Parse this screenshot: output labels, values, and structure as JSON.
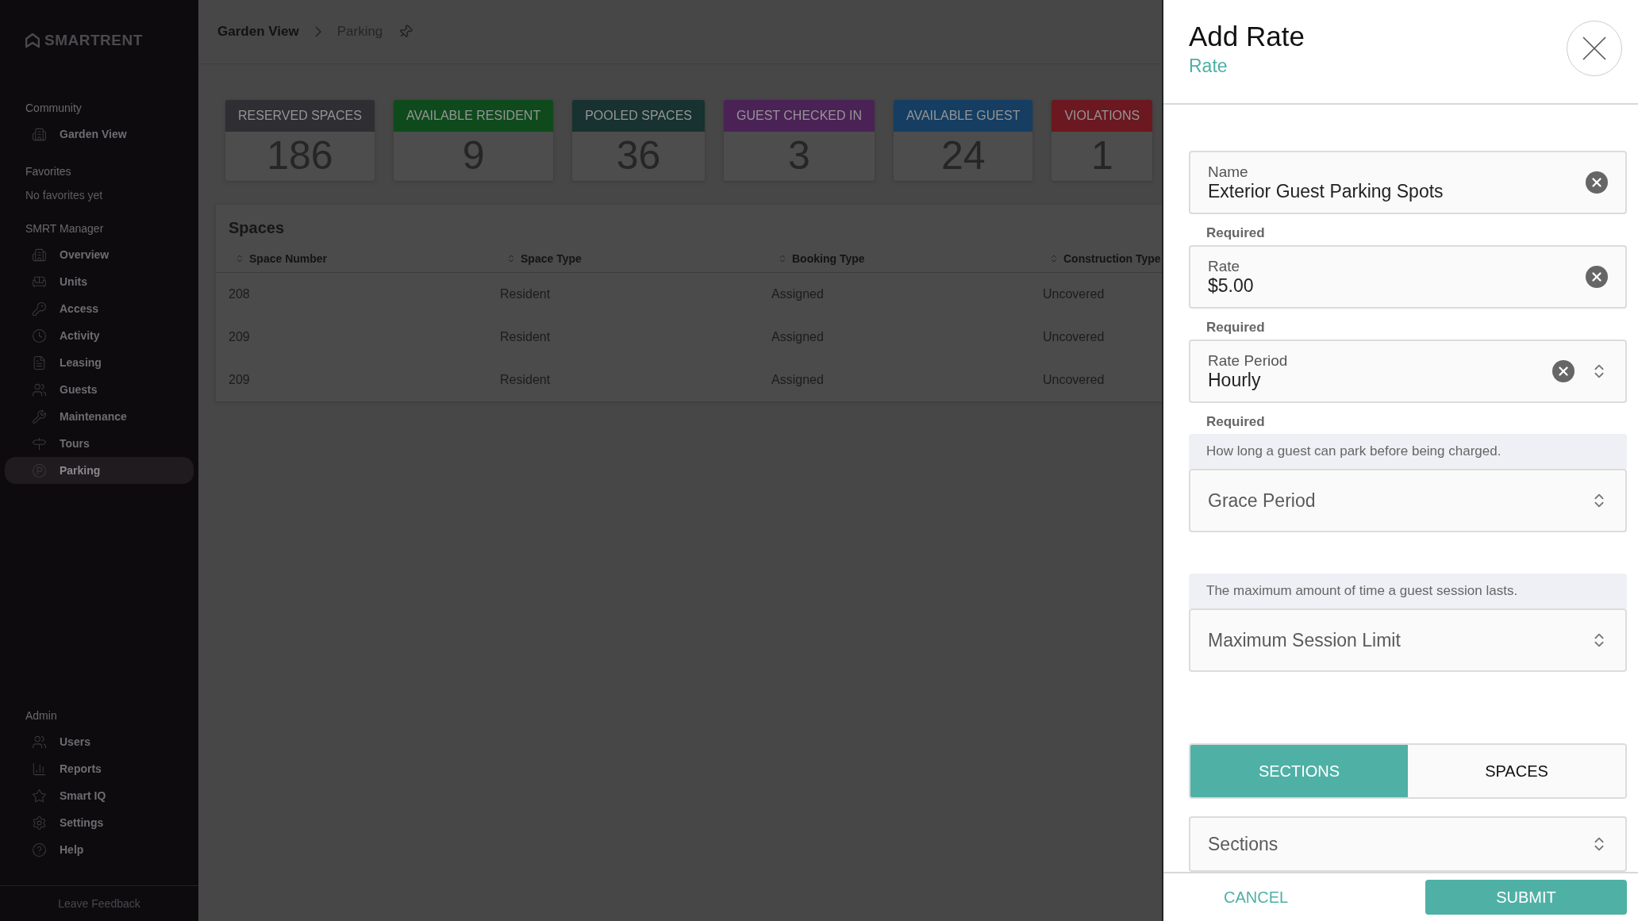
{
  "sidebar": {
    "logo": "SMARTRENT",
    "groups": [
      {
        "heading": "Community",
        "items": [
          {
            "label": "Garden View",
            "selected": false
          }
        ]
      },
      {
        "heading": "Favorites",
        "empty": "No favorites yet"
      },
      {
        "heading": "SMRT Manager",
        "items": [
          {
            "label": "Overview",
            "selected": false
          },
          {
            "label": "Units",
            "selected": false
          },
          {
            "label": "Access",
            "selected": false
          },
          {
            "label": "Activity",
            "selected": false
          },
          {
            "label": "Leasing",
            "selected": false
          },
          {
            "label": "Guests",
            "selected": false
          },
          {
            "label": "Maintenance",
            "selected": false
          },
          {
            "label": "Tours",
            "selected": false
          },
          {
            "label": "Parking",
            "selected": true
          }
        ]
      },
      {
        "heading": "Admin",
        "items": [
          {
            "label": "Users",
            "selected": false
          },
          {
            "label": "Reports",
            "selected": false
          },
          {
            "label": "Smart IQ",
            "selected": false
          },
          {
            "label": "Settings",
            "selected": false
          },
          {
            "label": "Help",
            "selected": false
          }
        ]
      }
    ],
    "feedback": "Leave Feedback"
  },
  "breadcrumb": [
    "Garden View",
    "Parking"
  ],
  "stats": [
    {
      "label": "RESERVED SPACES",
      "value": "186",
      "color": "#2e2e33"
    },
    {
      "label": "AVAILABLE RESIDENT",
      "value": "9",
      "color": "#0f4a1d"
    },
    {
      "label": "POOLED SPACES",
      "value": "36",
      "color": "#173230"
    },
    {
      "label": "GUEST CHECKED IN",
      "value": "3",
      "color": "#4b2256"
    },
    {
      "label": "AVAILABLE GUEST",
      "value": "24",
      "color": "#153e62"
    },
    {
      "label": "VIOLATIONS",
      "value": "1",
      "color": "#6b1820"
    }
  ],
  "table": {
    "title": "Spaces",
    "columns": [
      "Space Number",
      "Space Type",
      "Booking Type",
      "Construction Type"
    ],
    "rows": [
      [
        "208",
        "Resident",
        "Assigned",
        "Uncovered"
      ],
      [
        "209",
        "Resident",
        "Assigned",
        "Uncovered"
      ],
      [
        "209",
        "Resident",
        "Assigned",
        "Uncovered"
      ]
    ]
  },
  "drawer": {
    "title": "Add Rate",
    "subtitle": "Rate",
    "fields": [
      {
        "kind": "input",
        "label": "Name",
        "value": "Exterior Guest Parking Spots",
        "helper": "Required"
      },
      {
        "kind": "input",
        "label": "Rate",
        "value": "$5.00",
        "helper": "Required"
      },
      {
        "kind": "select",
        "label": "Rate Period",
        "value": "Hourly",
        "helper": "Required"
      },
      {
        "kind": "select",
        "hint": "How long a guest can park before being charged.",
        "placeholder": "Grace Period"
      },
      {
        "kind": "select",
        "hint": "The maximum amount of time a guest session lasts.",
        "placeholder": "Maximum Session Limit"
      }
    ],
    "tabs": [
      {
        "label": "SECTIONS",
        "selected": true
      },
      {
        "label": "SPACES",
        "selected": false
      }
    ],
    "picker": {
      "placeholder": "Sections"
    },
    "buttons": [
      {
        "kind": "text",
        "label": "CANCEL"
      },
      {
        "kind": "filled",
        "label": "SUBMIT"
      }
    ]
  }
}
